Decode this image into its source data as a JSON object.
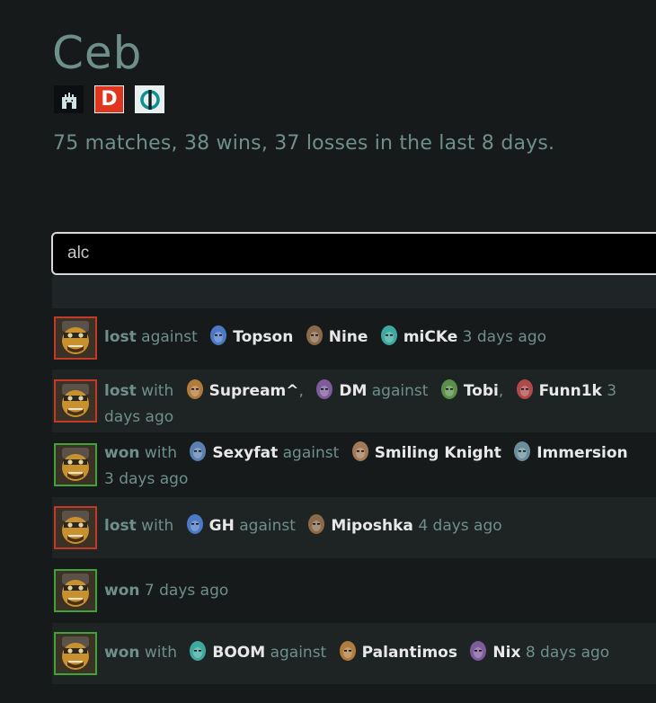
{
  "profile": {
    "name": "Ceb",
    "summary": "75 matches, 38 wins, 37 losses in the last 8 days.",
    "badges": [
      {
        "icon": "castle-icon",
        "color": "#0c0f12"
      },
      {
        "icon": "dotabuff-icon",
        "label": "D",
        "color": "#e0351f"
      },
      {
        "icon": "opendota-icon",
        "color": "#e8f0ef"
      }
    ]
  },
  "search": {
    "value": "alc"
  },
  "colors": {
    "lost": "#c03a26",
    "won": "#3fa33a",
    "muted_text": "#6f8f8b",
    "player_text": "#e8e8e8"
  },
  "matches": [
    {
      "hero_icon": "alchemist-icon",
      "result": "lost",
      "with": [],
      "against": [
        {
          "name": "Topson",
          "icon": "arc-warden-icon"
        },
        {
          "name": "Nine",
          "icon": "meepo-icon"
        },
        {
          "name": "miCKe",
          "icon": "monkey-king-icon"
        }
      ],
      "time": "3 days ago"
    },
    {
      "hero_icon": "alchemist-icon",
      "result": "lost",
      "with": [
        {
          "name": "Supream^",
          "icon": "hero-icon"
        },
        {
          "name": "DM",
          "icon": "weaver-icon"
        }
      ],
      "against": [
        {
          "name": "Tobi",
          "icon": "medusa-icon"
        },
        {
          "name": "Funn1k",
          "icon": "ancient-apparition-icon"
        }
      ],
      "time": "3 days ago"
    },
    {
      "hero_icon": "alchemist-icon",
      "result": "won",
      "with": [
        {
          "name": "Sexyfat",
          "icon": "hero-icon"
        }
      ],
      "against": [
        {
          "name": "Smiling Knight",
          "icon": "morphling-icon"
        },
        {
          "name": "Immersion",
          "icon": "hero-icon"
        }
      ],
      "time": "3 days ago"
    },
    {
      "hero_icon": "alchemist-icon",
      "result": "lost",
      "with": [
        {
          "name": "GH",
          "icon": "hero-icon"
        }
      ],
      "against": [
        {
          "name": "Miposhka",
          "icon": "hero-icon"
        }
      ],
      "time": "4 days ago"
    },
    {
      "hero_icon": "alchemist-icon",
      "result": "won",
      "with": [],
      "against": [],
      "time": "7 days ago"
    },
    {
      "hero_icon": "alchemist-icon",
      "result": "won",
      "with": [
        {
          "name": "BOOM",
          "icon": "hero-icon"
        }
      ],
      "against": [
        {
          "name": "Palantimos",
          "icon": "hero-icon"
        },
        {
          "name": "Nix",
          "icon": "hero-icon"
        }
      ],
      "time": "8 days ago"
    }
  ],
  "labels": {
    "with": "with",
    "against": "against",
    "separator": ","
  }
}
